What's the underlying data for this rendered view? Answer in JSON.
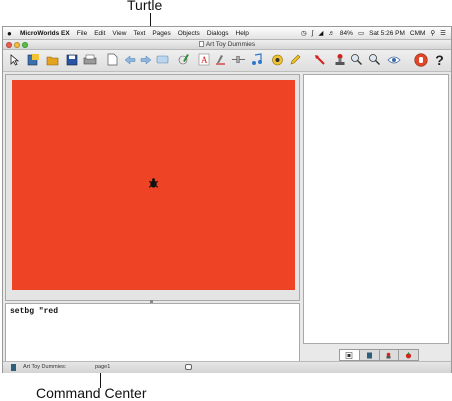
{
  "annotations": {
    "turtle_label": "Turtle",
    "command_center_label": "Command Center"
  },
  "menubar": {
    "app_name": "MicroWorlds EX",
    "menus": [
      "File",
      "Edit",
      "View",
      "Text",
      "Pages",
      "Objects",
      "Dialogs",
      "Help"
    ],
    "battery": "84%",
    "clock": "Sat 5:26 PM",
    "user": "CMM"
  },
  "window": {
    "title": "Art Toy Dummies"
  },
  "toolbar": {
    "icons": [
      "pointer-icon",
      "new-project-icon",
      "open-folder-icon",
      "save-icon",
      "print-icon",
      "new-page-icon",
      "back-arrow-icon",
      "forward-arrow-icon",
      "presentation-icon",
      "paint-icon",
      "text-box-icon",
      "turtle-tool-icon",
      "slider-tool-icon",
      "music-icon",
      "hatch-turtle-icon",
      "pencil-icon",
      "pointer-red-icon",
      "stamp-icon",
      "zoom-in-icon",
      "zoom-out-icon",
      "eye-icon",
      "stop-icon",
      "help-icon"
    ]
  },
  "canvas": {
    "background_color": "#ef4325"
  },
  "command_center": {
    "text": "setbg \"red"
  },
  "status_bar": {
    "project": "Art Toy Dummies:",
    "page": "page1"
  }
}
